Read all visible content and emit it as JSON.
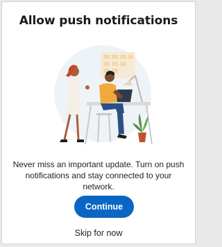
{
  "dialog": {
    "title": "Allow push notifications",
    "message_line1": "Never miss an important update. Turn on push",
    "message_line2": "notifications and stay connected to your network.",
    "illustration_icon": "people-working-illustration",
    "primary_button_label": "Continue",
    "secondary_link_label": "Skip for now"
  },
  "colors": {
    "primary": "#0a66c2",
    "title_text": "#1a1a1a",
    "body_text": "#1f1f1f",
    "background": "#ffffff"
  }
}
